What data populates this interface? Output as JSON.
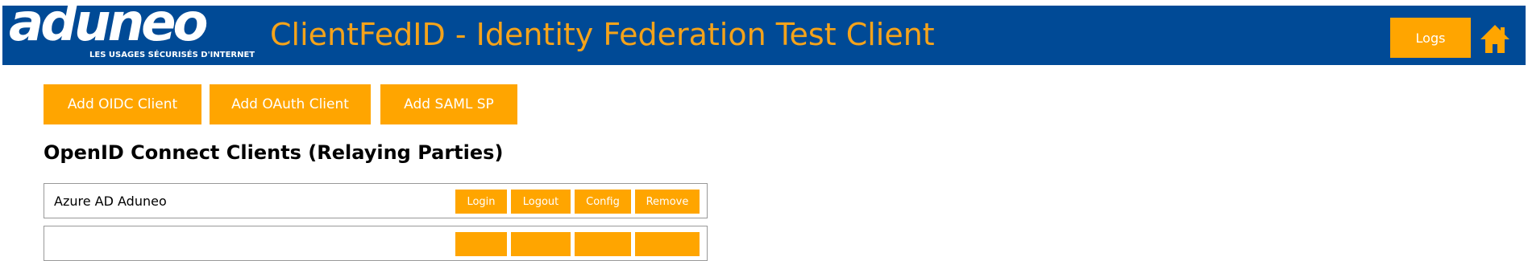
{
  "header": {
    "logo_word": "aduneo",
    "logo_tagline": "LES USAGES SÉCURISÉS D'INTERNET",
    "title": "ClientFedID - Identity Federation Test Client",
    "logs_label": "Logs",
    "home_icon": "home-icon",
    "background_color": "#004a96",
    "title_color": "#f5a31a",
    "accent_color": "#ffa500"
  },
  "actions": {
    "add_oidc_label": "Add OIDC Client",
    "add_oauth_label": "Add OAuth Client",
    "add_saml_label": "Add SAML SP"
  },
  "oidc_section": {
    "title": "OpenID Connect Clients (Relaying Parties)",
    "clients": [
      {
        "name": "Azure AD Aduneo",
        "login_label": "Login",
        "logout_label": "Logout",
        "config_label": "Config",
        "remove_label": "Remove"
      },
      {
        "name": "",
        "login_label": "",
        "logout_label": "",
        "config_label": "",
        "remove_label": ""
      }
    ]
  }
}
